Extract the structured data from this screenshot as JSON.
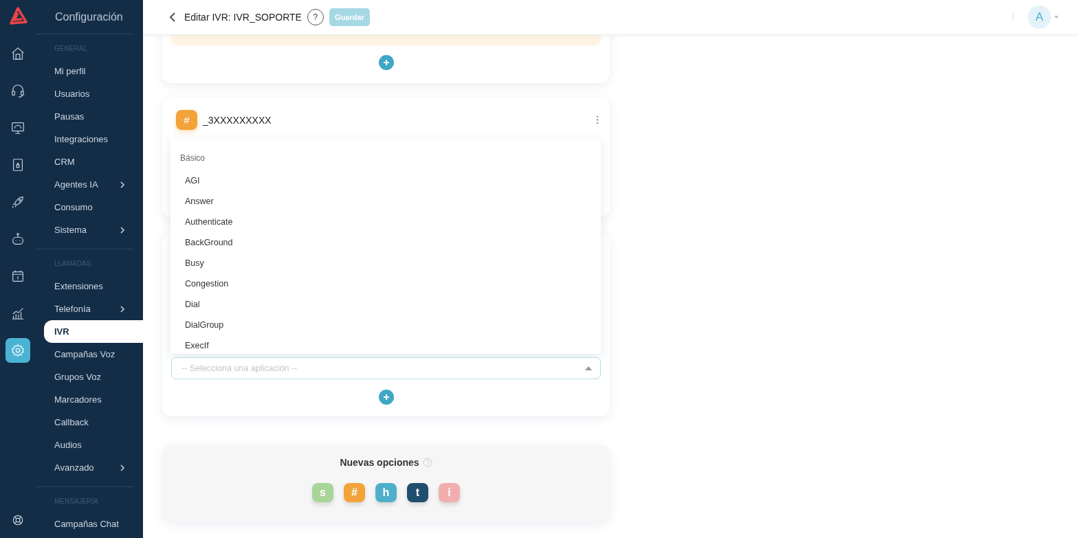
{
  "sidebar": {
    "title": "Configuración",
    "rail": [
      {
        "kind": "home",
        "selected": false
      },
      {
        "kind": "headset",
        "selected": false
      },
      {
        "kind": "monitor",
        "selected": false
      },
      {
        "kind": "document",
        "selected": false
      },
      {
        "kind": "rocket",
        "selected": false
      },
      {
        "kind": "robot",
        "selected": false
      },
      {
        "kind": "calendar",
        "selected": false
      },
      {
        "kind": "chart",
        "selected": false
      },
      {
        "kind": "settings",
        "selected": true
      }
    ],
    "sections": [
      {
        "heading": "GENERAL",
        "items": [
          {
            "label": "Mi perfil",
            "submenu": false,
            "selected": false
          },
          {
            "label": "Usuarios",
            "submenu": false,
            "selected": false
          },
          {
            "label": "Pausas",
            "submenu": false,
            "selected": false
          },
          {
            "label": "Integraciones",
            "submenu": false,
            "selected": false
          },
          {
            "label": "CRM",
            "submenu": false,
            "selected": false
          },
          {
            "label": "Agentes IA",
            "submenu": true,
            "selected": false
          },
          {
            "label": "Consumo",
            "submenu": false,
            "selected": false
          },
          {
            "label": "Sistema",
            "submenu": true,
            "selected": false
          }
        ]
      },
      {
        "heading": "LLAMADAS",
        "items": [
          {
            "label": "Extensiones",
            "submenu": false,
            "selected": false
          },
          {
            "label": "Telefonía",
            "submenu": true,
            "selected": false
          },
          {
            "label": "IVR",
            "submenu": false,
            "selected": true
          },
          {
            "label": "Campañas Voz",
            "submenu": false,
            "selected": false
          },
          {
            "label": "Grupos Voz",
            "submenu": false,
            "selected": false
          },
          {
            "label": "Marcadores",
            "submenu": false,
            "selected": false
          },
          {
            "label": "Callback",
            "submenu": false,
            "selected": false
          },
          {
            "label": "Audios",
            "submenu": false,
            "selected": false
          },
          {
            "label": "Avanzado",
            "submenu": true,
            "selected": false
          }
        ]
      },
      {
        "heading": "MENSAJERÍA",
        "items": [
          {
            "label": "Campañas Chat",
            "submenu": false,
            "selected": false
          }
        ]
      }
    ]
  },
  "header": {
    "title": "Editar IVR: IVR_SOPORTE",
    "help": "?",
    "save": {
      "label": "Guardar",
      "disabled": true
    },
    "avatar": "A"
  },
  "option_card": {
    "badge": "#",
    "title": "_3XXXXXXXXX"
  },
  "app_select": {
    "placeholder": "-- Selecciona una aplicación --",
    "expanded": true,
    "dropdown": {
      "group": "Básico",
      "options": [
        "AGI",
        "Answer",
        "Authenticate",
        "BackGround",
        "Busy",
        "Congestion",
        "Dial",
        "DialGroup",
        "ExecIf"
      ]
    }
  },
  "new_options": {
    "title": "Nuevas opciones",
    "badges": [
      {
        "label": "s",
        "color": "#a8d598"
      },
      {
        "label": "#",
        "color": "#f2a33a"
      },
      {
        "label": "h",
        "color": "#4fafcb"
      },
      {
        "label": "t",
        "color": "#1f4e6e"
      },
      {
        "label": "i",
        "color": "#f2aeae"
      }
    ]
  }
}
